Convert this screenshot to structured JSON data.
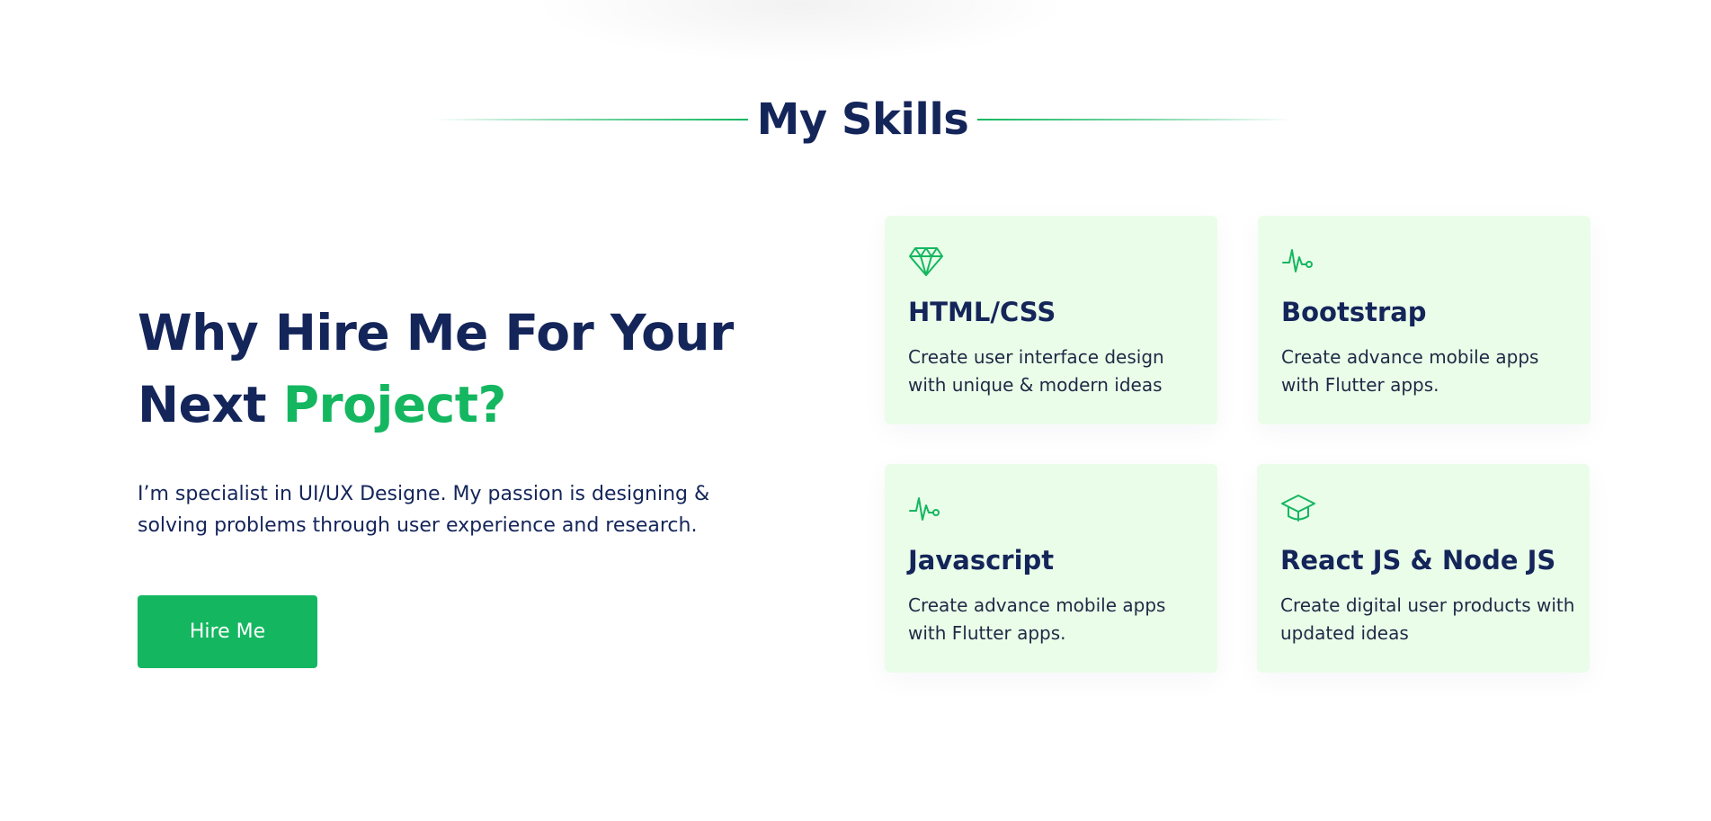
{
  "section": {
    "title": "My Skills"
  },
  "intro": {
    "headline_line1": "Why Hire Me For Your",
    "headline_line2_plain": "Next ",
    "headline_line2_accent": "Project?",
    "description": "I’m specialist in UI/UX Designe. My passion is designing & solving problems through user experience and research.",
    "button_label": "Hire Me"
  },
  "skills": [
    {
      "icon": "diamond-icon",
      "title": "HTML/CSS",
      "description": "Create user interface design with unique & modern ideas"
    },
    {
      "icon": "pulse-icon",
      "title": "Bootstrap",
      "description": "Create advance mobile apps with Flutter apps."
    },
    {
      "icon": "pulse-icon",
      "title": "Javascript",
      "description": "Create advance mobile apps with Flutter apps."
    },
    {
      "icon": "graduation-cap-icon",
      "title": "React JS & Node JS",
      "description": "Create digital user products with updated ideas"
    }
  ],
  "colors": {
    "navy": "#14255a",
    "green": "#14b760",
    "card_bg": "#eafde9"
  }
}
